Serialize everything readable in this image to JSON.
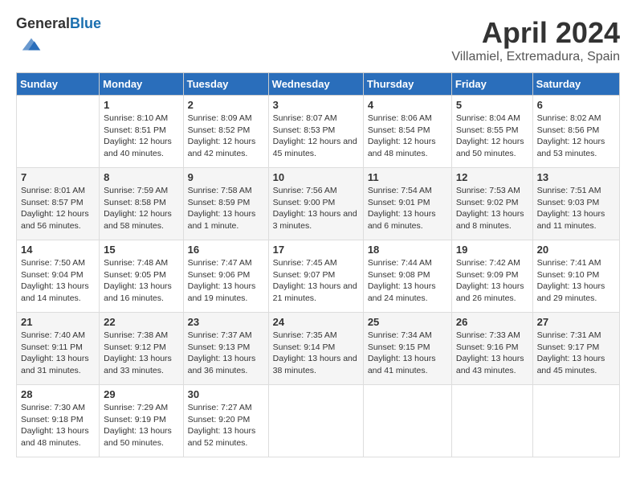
{
  "header": {
    "logo_general": "General",
    "logo_blue": "Blue",
    "month_year": "April 2024",
    "location": "Villamiel, Extremadura, Spain"
  },
  "weekdays": [
    "Sunday",
    "Monday",
    "Tuesday",
    "Wednesday",
    "Thursday",
    "Friday",
    "Saturday"
  ],
  "weeks": [
    [
      {
        "day": "",
        "sunrise": "",
        "sunset": "",
        "daylight": ""
      },
      {
        "day": "1",
        "sunrise": "Sunrise: 8:10 AM",
        "sunset": "Sunset: 8:51 PM",
        "daylight": "Daylight: 12 hours and 40 minutes."
      },
      {
        "day": "2",
        "sunrise": "Sunrise: 8:09 AM",
        "sunset": "Sunset: 8:52 PM",
        "daylight": "Daylight: 12 hours and 42 minutes."
      },
      {
        "day": "3",
        "sunrise": "Sunrise: 8:07 AM",
        "sunset": "Sunset: 8:53 PM",
        "daylight": "Daylight: 12 hours and 45 minutes."
      },
      {
        "day": "4",
        "sunrise": "Sunrise: 8:06 AM",
        "sunset": "Sunset: 8:54 PM",
        "daylight": "Daylight: 12 hours and 48 minutes."
      },
      {
        "day": "5",
        "sunrise": "Sunrise: 8:04 AM",
        "sunset": "Sunset: 8:55 PM",
        "daylight": "Daylight: 12 hours and 50 minutes."
      },
      {
        "day": "6",
        "sunrise": "Sunrise: 8:02 AM",
        "sunset": "Sunset: 8:56 PM",
        "daylight": "Daylight: 12 hours and 53 minutes."
      }
    ],
    [
      {
        "day": "7",
        "sunrise": "Sunrise: 8:01 AM",
        "sunset": "Sunset: 8:57 PM",
        "daylight": "Daylight: 12 hours and 56 minutes."
      },
      {
        "day": "8",
        "sunrise": "Sunrise: 7:59 AM",
        "sunset": "Sunset: 8:58 PM",
        "daylight": "Daylight: 12 hours and 58 minutes."
      },
      {
        "day": "9",
        "sunrise": "Sunrise: 7:58 AM",
        "sunset": "Sunset: 8:59 PM",
        "daylight": "Daylight: 13 hours and 1 minute."
      },
      {
        "day": "10",
        "sunrise": "Sunrise: 7:56 AM",
        "sunset": "Sunset: 9:00 PM",
        "daylight": "Daylight: 13 hours and 3 minutes."
      },
      {
        "day": "11",
        "sunrise": "Sunrise: 7:54 AM",
        "sunset": "Sunset: 9:01 PM",
        "daylight": "Daylight: 13 hours and 6 minutes."
      },
      {
        "day": "12",
        "sunrise": "Sunrise: 7:53 AM",
        "sunset": "Sunset: 9:02 PM",
        "daylight": "Daylight: 13 hours and 8 minutes."
      },
      {
        "day": "13",
        "sunrise": "Sunrise: 7:51 AM",
        "sunset": "Sunset: 9:03 PM",
        "daylight": "Daylight: 13 hours and 11 minutes."
      }
    ],
    [
      {
        "day": "14",
        "sunrise": "Sunrise: 7:50 AM",
        "sunset": "Sunset: 9:04 PM",
        "daylight": "Daylight: 13 hours and 14 minutes."
      },
      {
        "day": "15",
        "sunrise": "Sunrise: 7:48 AM",
        "sunset": "Sunset: 9:05 PM",
        "daylight": "Daylight: 13 hours and 16 minutes."
      },
      {
        "day": "16",
        "sunrise": "Sunrise: 7:47 AM",
        "sunset": "Sunset: 9:06 PM",
        "daylight": "Daylight: 13 hours and 19 minutes."
      },
      {
        "day": "17",
        "sunrise": "Sunrise: 7:45 AM",
        "sunset": "Sunset: 9:07 PM",
        "daylight": "Daylight: 13 hours and 21 minutes."
      },
      {
        "day": "18",
        "sunrise": "Sunrise: 7:44 AM",
        "sunset": "Sunset: 9:08 PM",
        "daylight": "Daylight: 13 hours and 24 minutes."
      },
      {
        "day": "19",
        "sunrise": "Sunrise: 7:42 AM",
        "sunset": "Sunset: 9:09 PM",
        "daylight": "Daylight: 13 hours and 26 minutes."
      },
      {
        "day": "20",
        "sunrise": "Sunrise: 7:41 AM",
        "sunset": "Sunset: 9:10 PM",
        "daylight": "Daylight: 13 hours and 29 minutes."
      }
    ],
    [
      {
        "day": "21",
        "sunrise": "Sunrise: 7:40 AM",
        "sunset": "Sunset: 9:11 PM",
        "daylight": "Daylight: 13 hours and 31 minutes."
      },
      {
        "day": "22",
        "sunrise": "Sunrise: 7:38 AM",
        "sunset": "Sunset: 9:12 PM",
        "daylight": "Daylight: 13 hours and 33 minutes."
      },
      {
        "day": "23",
        "sunrise": "Sunrise: 7:37 AM",
        "sunset": "Sunset: 9:13 PM",
        "daylight": "Daylight: 13 hours and 36 minutes."
      },
      {
        "day": "24",
        "sunrise": "Sunrise: 7:35 AM",
        "sunset": "Sunset: 9:14 PM",
        "daylight": "Daylight: 13 hours and 38 minutes."
      },
      {
        "day": "25",
        "sunrise": "Sunrise: 7:34 AM",
        "sunset": "Sunset: 9:15 PM",
        "daylight": "Daylight: 13 hours and 41 minutes."
      },
      {
        "day": "26",
        "sunrise": "Sunrise: 7:33 AM",
        "sunset": "Sunset: 9:16 PM",
        "daylight": "Daylight: 13 hours and 43 minutes."
      },
      {
        "day": "27",
        "sunrise": "Sunrise: 7:31 AM",
        "sunset": "Sunset: 9:17 PM",
        "daylight": "Daylight: 13 hours and 45 minutes."
      }
    ],
    [
      {
        "day": "28",
        "sunrise": "Sunrise: 7:30 AM",
        "sunset": "Sunset: 9:18 PM",
        "daylight": "Daylight: 13 hours and 48 minutes."
      },
      {
        "day": "29",
        "sunrise": "Sunrise: 7:29 AM",
        "sunset": "Sunset: 9:19 PM",
        "daylight": "Daylight: 13 hours and 50 minutes."
      },
      {
        "day": "30",
        "sunrise": "Sunrise: 7:27 AM",
        "sunset": "Sunset: 9:20 PM",
        "daylight": "Daylight: 13 hours and 52 minutes."
      },
      {
        "day": "",
        "sunrise": "",
        "sunset": "",
        "daylight": ""
      },
      {
        "day": "",
        "sunrise": "",
        "sunset": "",
        "daylight": ""
      },
      {
        "day": "",
        "sunrise": "",
        "sunset": "",
        "daylight": ""
      },
      {
        "day": "",
        "sunrise": "",
        "sunset": "",
        "daylight": ""
      }
    ]
  ]
}
